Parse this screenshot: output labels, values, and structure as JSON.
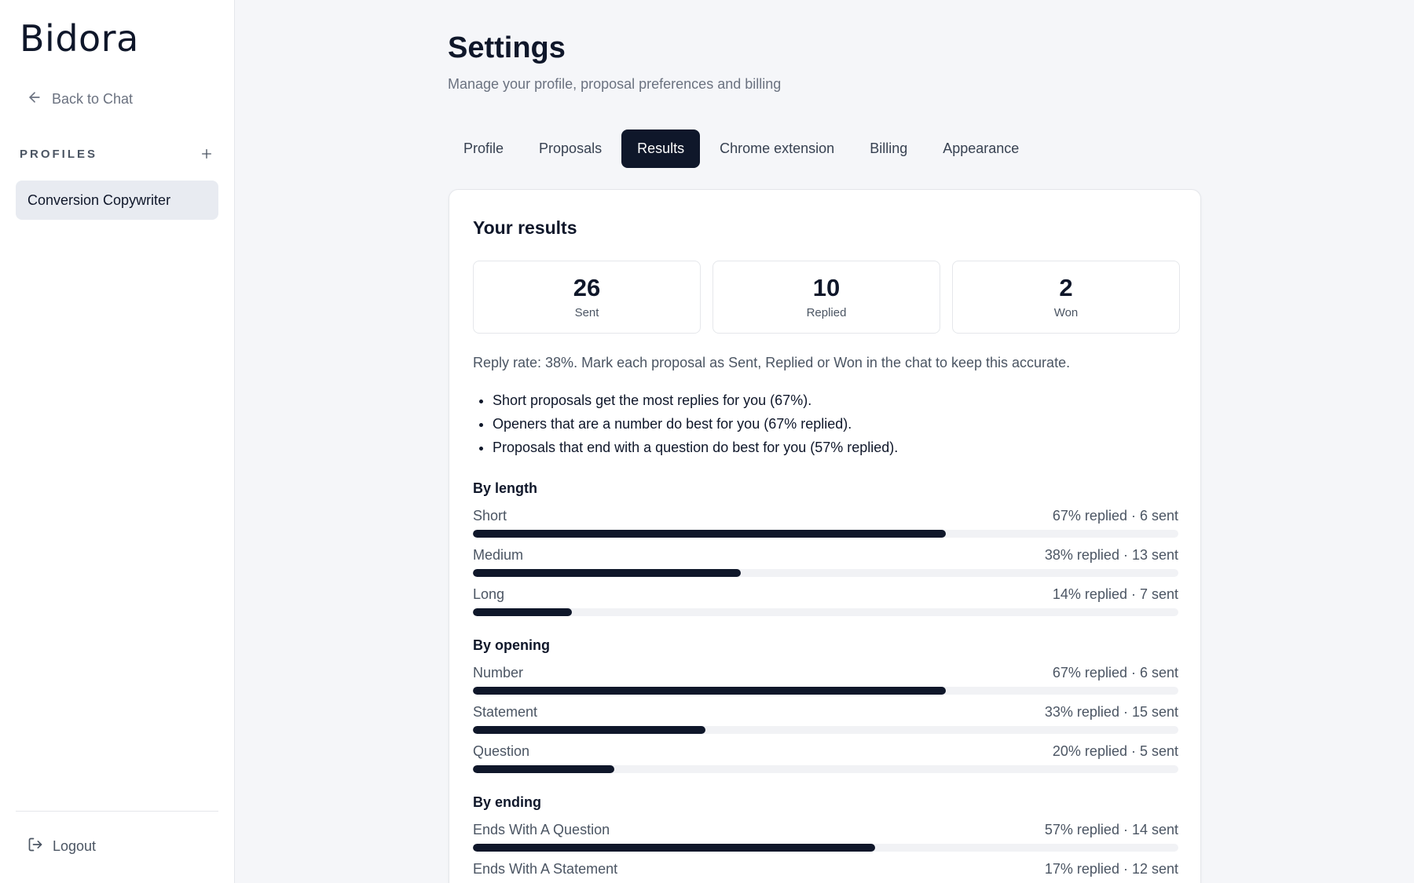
{
  "sidebar": {
    "logo": "Bidora",
    "back_label": "Back to Chat",
    "profiles_label": "PROFILES",
    "profiles": [
      "Conversion Copywriter"
    ],
    "logout_label": "Logout"
  },
  "header": {
    "title": "Settings",
    "subtitle": "Manage your profile, proposal preferences and billing"
  },
  "tabs": [
    {
      "label": "Profile",
      "active": false
    },
    {
      "label": "Proposals",
      "active": false
    },
    {
      "label": "Results",
      "active": true
    },
    {
      "label": "Chrome extension",
      "active": false
    },
    {
      "label": "Billing",
      "active": false
    },
    {
      "label": "Appearance",
      "active": false
    }
  ],
  "results": {
    "title": "Your results",
    "stats": [
      {
        "value": "26",
        "label": "Sent"
      },
      {
        "value": "10",
        "label": "Replied"
      },
      {
        "value": "2",
        "label": "Won"
      }
    ],
    "reply_note": "Reply rate: 38%. Mark each proposal as Sent, Replied or Won in the chat to keep this accurate.",
    "insights": [
      "Short proposals get the most replies for you (67%).",
      "Openers that are a number do best for you (67% replied).",
      "Proposals that end with a question do best for you (57% replied)."
    ],
    "sections": [
      {
        "title": "By length",
        "rows": [
          {
            "label": "Short",
            "stat": "67% replied · 6 sent",
            "percent": 67
          },
          {
            "label": "Medium",
            "stat": "38% replied · 13 sent",
            "percent": 38
          },
          {
            "label": "Long",
            "stat": "14% replied · 7 sent",
            "percent": 14
          }
        ]
      },
      {
        "title": "By opening",
        "rows": [
          {
            "label": "Number",
            "stat": "67% replied · 6 sent",
            "percent": 67
          },
          {
            "label": "Statement",
            "stat": "33% replied · 15 sent",
            "percent": 33
          },
          {
            "label": "Question",
            "stat": "20% replied · 5 sent",
            "percent": 20
          }
        ]
      },
      {
        "title": "By ending",
        "rows": [
          {
            "label": "Ends With A Question",
            "stat": "57% replied · 14 sent",
            "percent": 57
          },
          {
            "label": "Ends With A Statement",
            "stat": "17% replied · 12 sent",
            "percent": 17
          }
        ]
      }
    ]
  },
  "colors": {
    "accent": "#0f172a",
    "track": "#f1f2f5",
    "muted_text": "#6b7280",
    "active_profile_bg": "#e8ebf1"
  },
  "icons": {
    "back": "arrow-left-icon",
    "add": "plus-icon",
    "logout": "logout-icon"
  }
}
